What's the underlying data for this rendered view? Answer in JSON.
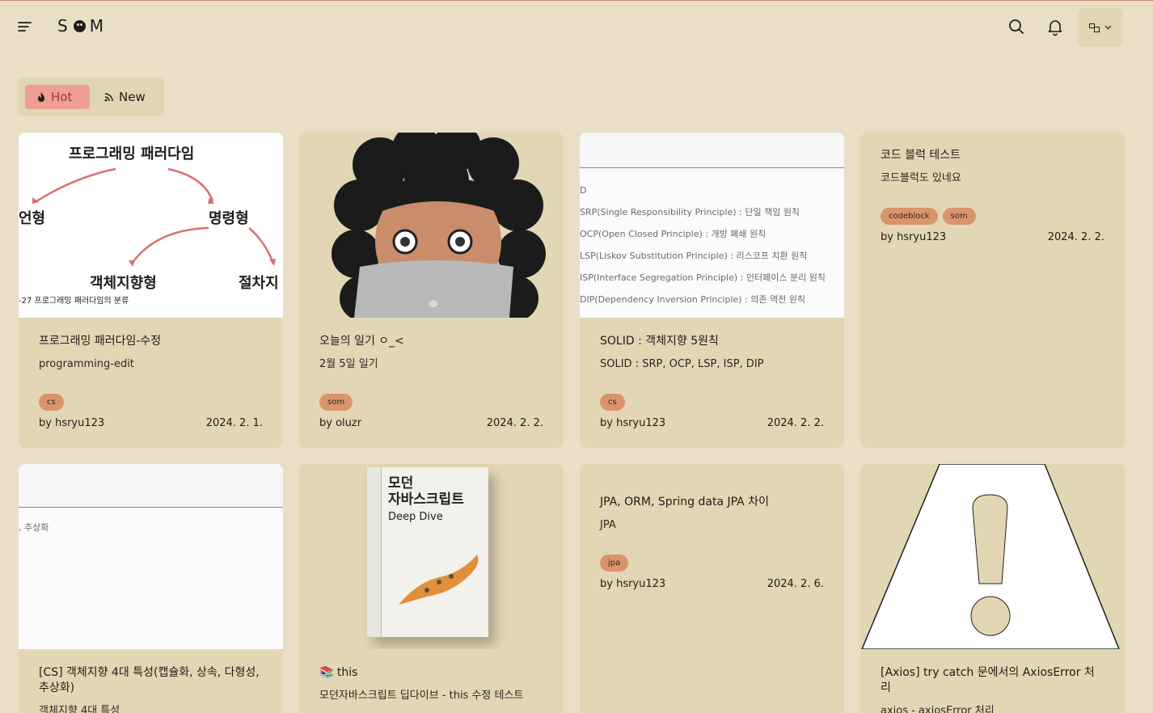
{
  "header": {
    "logo": {
      "left": "S",
      "right": "M"
    },
    "lang_icon": "translate-icon"
  },
  "filter_tabs": [
    {
      "label": "Hot",
      "icon": "fire-icon",
      "active": true
    },
    {
      "label": "New",
      "icon": "rss-icon",
      "active": false
    }
  ],
  "posts": [
    {
      "title": "프로그래밍 패러다임-수정",
      "description": "programming-edit",
      "tags": [
        "cs"
      ],
      "author": "by hsryu123",
      "date": "2024. 2. 1.",
      "image": {
        "heading": "프로그래밍 패러다임",
        "left_word": "언형",
        "right_word": "명령형",
        "mid_word": "객체지향형",
        "far_right_word": "절차지",
        "caption": "-27 프로그래밍 패러다임의 분류"
      }
    },
    {
      "title": "오늘의 일기 ㅇ_<",
      "description": "2월 5일 일기",
      "tags": [
        "som"
      ],
      "author": "by oluzr",
      "date": "2024. 2. 2."
    },
    {
      "title": "SOLID : 객체지향 5원칙",
      "description": "SOLID : SRP, OCP, LSP, ISP, DIP",
      "tags": [
        "cs"
      ],
      "author": "by hsryu123",
      "date": "2024. 2. 2.",
      "image": {
        "lines": [
          "D",
          "SRP(Single Responsibility Principle) : 단일 책임 원칙",
          "OCP(Open Closed Principle) : 개방 폐쇄 원칙",
          "LSP(Liskov Substitution Principle) : 리스코프 치환 원칙",
          "ISP(Interface Segregation Principle) : 인터페이스 분리 원칙",
          "DIP(Dependency Inversion Principle) : 의존 역전 원칙"
        ]
      }
    },
    {
      "title": "코드 블럭 테스트",
      "description": "코드블럭도 있네요",
      "tags": [
        "codeblock",
        "som"
      ],
      "author": "by hsryu123",
      "date": "2024. 2. 2."
    },
    {
      "title": "[CS] 객체지향 4대 특성(캡슐화, 상속, 다형성, 추상화)",
      "description": "객체지향 4대 특성",
      "image": {
        "text": ", 추상화"
      }
    },
    {
      "title": "📚 this",
      "description": "모던자바스크립트 딥다이브 - this 수정 테스트",
      "image": {
        "book_title_1": "모던",
        "book_title_2": "자바스크립트",
        "book_subtitle": "Deep Dive"
      }
    },
    {
      "title": "JPA, ORM, Spring data JPA 차이",
      "description": "JPA",
      "tags": [
        "jpa"
      ],
      "author": "by hsryu123",
      "date": "2024. 2. 6."
    },
    {
      "title": "[Axios] try catch 문에서의 AxiosError 처리",
      "description": "axios - axiosError 처리",
      "image": {
        "icon": "warning-icon"
      }
    }
  ],
  "colors": {
    "background": "#e8dfc6",
    "card": "#e3d6b4",
    "tag": "#d9946c",
    "hot_tab": "#ef9e94"
  }
}
